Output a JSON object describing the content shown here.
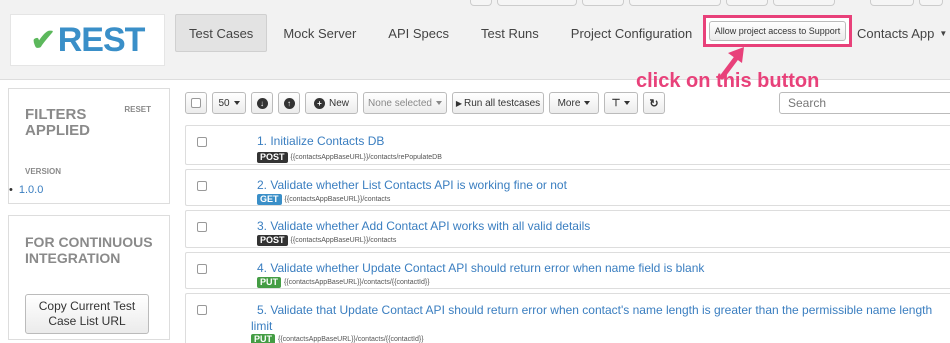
{
  "app": {
    "logo_text": "REST"
  },
  "nav": {
    "items": [
      {
        "label": "Test Cases"
      },
      {
        "label": "Mock Server"
      },
      {
        "label": "API Specs"
      },
      {
        "label": "Test Runs"
      },
      {
        "label": "Project Configuration"
      }
    ],
    "support_button": "Allow project access to Support",
    "project_menu": "Contacts App"
  },
  "annotation": {
    "text": "click on this button",
    "color": "#e8417a"
  },
  "sidebar": {
    "filters_title": "FILTERS APPLIED",
    "reset_label": "RESET",
    "version_label": "VERSION",
    "version_bullet": "•",
    "version_value": "1.0.0",
    "ci_title": "FOR CONTINUOUS INTEGRATION",
    "copy_button": "Copy Current Test Case List URL"
  },
  "toolbar": {
    "page_size": "50",
    "new_label": "New",
    "selection": "None selected",
    "run_all": "Run all testcases",
    "more": "More",
    "search_placeholder": "Search"
  },
  "testcases": [
    {
      "title": "1.  Initialize Contacts DB",
      "method": "POST",
      "path": "{{contactsAppBaseURL}}/contacts/rePopulateDB"
    },
    {
      "title": "2.  Validate whether List Contacts API is working fine or not",
      "method": "GET",
      "path": "{{contactsAppBaseURL}}/contacts"
    },
    {
      "title": "3.  Validate whether Add Contact API works with all valid details",
      "method": "POST",
      "path": "{{contactsAppBaseURL}}/contacts"
    },
    {
      "title": "4.  Validate whether Update Contact API should return error when name field is blank",
      "method": "PUT",
      "path": "{{contactsAppBaseURL}}/contacts/{{contactId}}"
    },
    {
      "title": "5.  Validate that Update Contact API should return error when contact's name length is greater than the permissible name length limit",
      "method": "PUT",
      "path": "{{contactsAppBaseURL}}/contacts/{{contactId}}"
    }
  ]
}
